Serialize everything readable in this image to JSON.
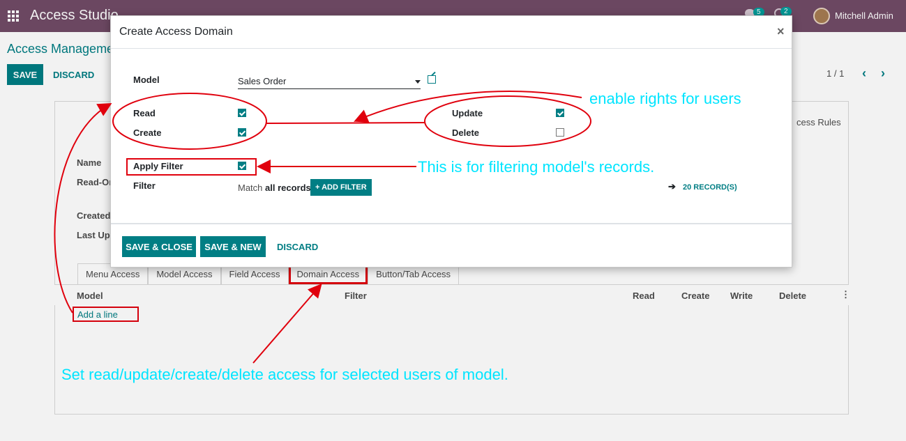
{
  "navbar": {
    "app_title": "Access Studio",
    "messages_count": "5",
    "activities_count": "2",
    "user_name": "Mitchell Admin"
  },
  "control_panel": {
    "breadcrumb": "Access Manageme",
    "save_label": "SAVE",
    "discard_label": "DISCARD",
    "pager": "1 / 1"
  },
  "form": {
    "name_label": "Name",
    "readonly_label": "Read-On",
    "created_label": "Created",
    "last_updated_label": "Last Upd",
    "rules_label": "cess Rules"
  },
  "tabs": [
    {
      "label": "Menu Access"
    },
    {
      "label": "Model Access"
    },
    {
      "label": "Field Access"
    },
    {
      "label": "Domain Access"
    },
    {
      "label": "Button/Tab Access"
    }
  ],
  "table": {
    "columns": [
      "Model",
      "Filter",
      "Read",
      "Create",
      "Write",
      "Delete"
    ],
    "add_line": "Add a line"
  },
  "modal": {
    "title": "Create Access Domain",
    "close": "×",
    "model_label": "Model",
    "model_value": "Sales Order",
    "read_label": "Read",
    "read_checked": true,
    "create_label": "Create",
    "create_checked": true,
    "update_label": "Update",
    "update_checked": true,
    "delete_label": "Delete",
    "delete_checked": false,
    "apply_filter_label": "Apply Filter",
    "apply_filter_checked": true,
    "filter_label": "Filter",
    "match_prefix": "Match",
    "match_bold": "all records",
    "add_filter": "+ ADD FILTER",
    "records_count": "20 RECORD(S)",
    "save_close": "SAVE & CLOSE",
    "save_new": "SAVE & NEW",
    "discard": "DISCARD"
  },
  "annotations": {
    "rights_note": "enable rights for users",
    "filter_note": "This is for filtering model's records.",
    "access_note": "Set read/update/create/delete access for selected users of model.",
    "annotation_color": "#00e5ff",
    "marker_color": "#e0000d"
  },
  "colors": {
    "navbar": "#714b67",
    "primary": "#017e84"
  }
}
